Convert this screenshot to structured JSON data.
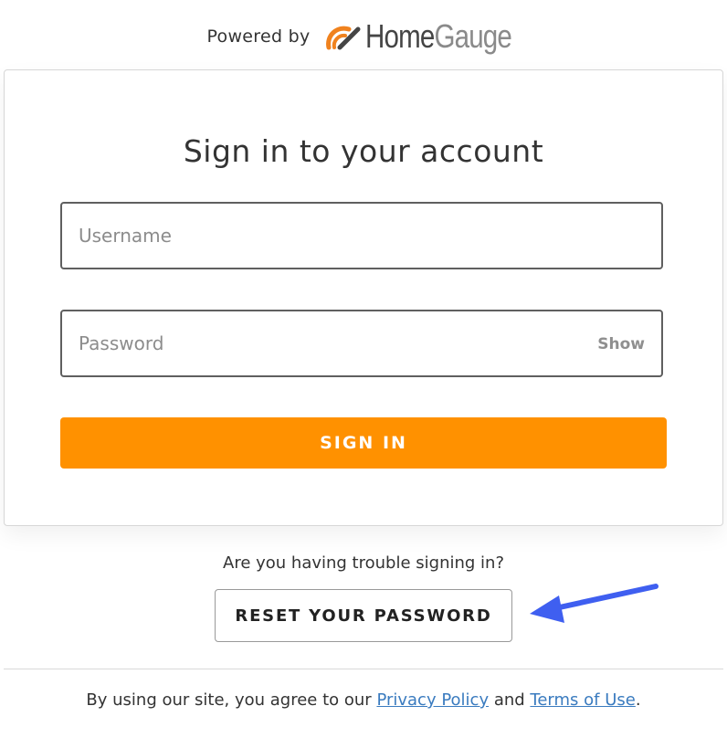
{
  "header": {
    "powered_by": "Powered by",
    "logo_home": "Home",
    "logo_gauge": "Gauge",
    "logo_icon": "gauge-icon"
  },
  "form": {
    "title": "Sign in to your account",
    "username_placeholder": "Username",
    "username_value": "",
    "password_placeholder": "Password",
    "password_value": "",
    "show_label": "Show",
    "signin_label": "SIGN IN"
  },
  "help": {
    "trouble_text": "Are you having trouble signing in?",
    "reset_label": "RESET YOUR PASSWORD",
    "arrow_icon": "arrow-left-icon"
  },
  "footer": {
    "prefix": "By using our site, you agree to our ",
    "privacy_label": "Privacy Policy",
    "middle": " and ",
    "terms_label": "Terms of Use",
    "suffix": "."
  },
  "colors": {
    "accent": "#ff9100",
    "link": "#3a7bbf",
    "arrow": "#3f5ff0",
    "logo_icon": "#f0821e"
  }
}
